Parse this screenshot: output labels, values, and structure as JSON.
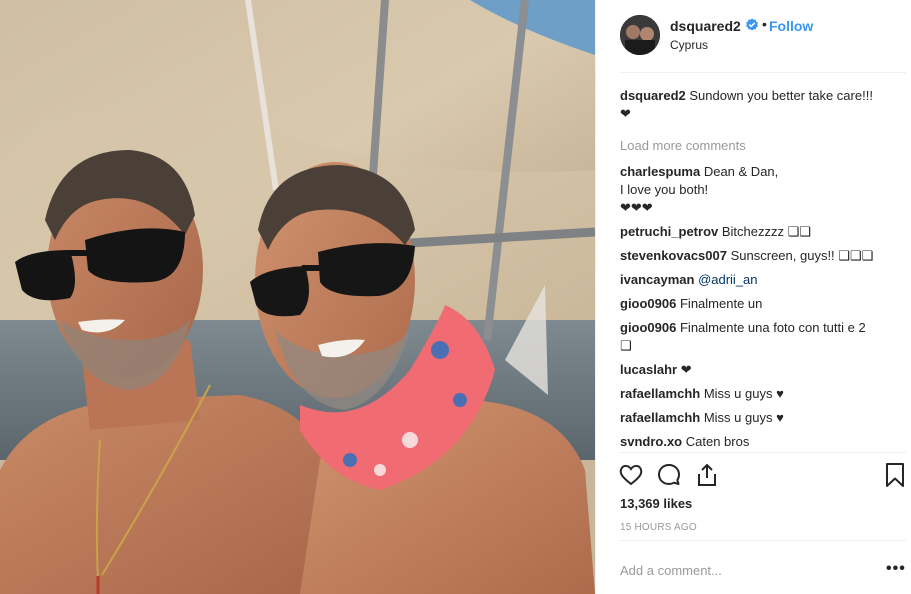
{
  "post": {
    "username": "dsquared2",
    "follow_label": "Follow",
    "separator": "•",
    "location": "Cyprus"
  },
  "caption": {
    "username": "dsquared2",
    "text": "Sundown you better take care!!!",
    "emoji_line": "❤"
  },
  "load_more_label": "Load more comments",
  "comments": [
    {
      "username": "charlespuma",
      "text": "Dean & Dan,",
      "line2": "I love you both!",
      "line3": "❤❤❤"
    },
    {
      "username": "petruchi_petrov",
      "text": "Bitchezzzz ❑❑"
    },
    {
      "username": "stevenkovacs007",
      "text": "Sunscreen, guys!! ❑❑❑"
    },
    {
      "username": "ivancayman",
      "mention": "@adrii_an"
    },
    {
      "username": "gioo0906",
      "text": "Finalmente un"
    },
    {
      "username": "gioo0906",
      "text": "Finalmente una foto con tutti e 2",
      "line2": "❑"
    },
    {
      "username": "lucaslahr",
      "text": "❤"
    },
    {
      "username": "rafaellamchh",
      "text": "Miss u guys ♥"
    },
    {
      "username": "rafaellamchh",
      "text": "Miss u guys ♥"
    },
    {
      "username": "svndro.xo",
      "text": "Caten bros"
    }
  ],
  "likes_label": "13,369 likes",
  "time_label": "15 HOURS AGO",
  "add_comment_placeholder": "Add a comment...",
  "more_options_label": "•••",
  "icons": {
    "like": "heart-icon",
    "comment": "comment-icon",
    "share": "share-icon",
    "save": "bookmark-icon",
    "verified": "verified-badge-icon"
  },
  "colors": {
    "link_blue": "#3897f0",
    "muted_gray": "#999999",
    "text": "#262626",
    "mention": "#003569"
  }
}
